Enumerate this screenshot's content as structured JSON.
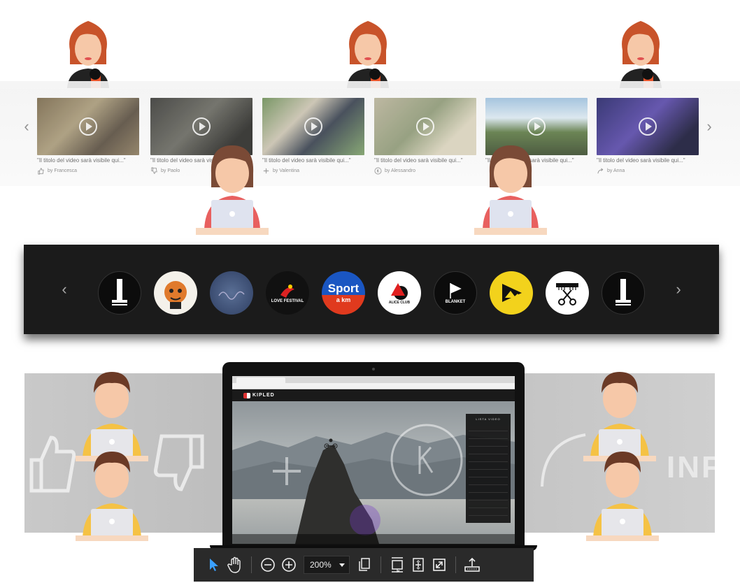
{
  "video_strip": {
    "videos": [
      {
        "title": "\"Il titolo del video sarà visibile qui...\"",
        "author": "by Francesca",
        "icon": "thumbs-up-icon"
      },
      {
        "title": "\"Il titolo del video sarà visibile qui...\"",
        "author": "by Paolo",
        "icon": "thumbs-down-icon"
      },
      {
        "title": "\"Il titolo del video sarà visibile qui...\"",
        "author": "by Valentina",
        "icon": "plus-icon"
      },
      {
        "title": "\"Il titolo del video sarà visibile qui...\"",
        "author": "by Alessandro",
        "icon": "k-circle-icon"
      },
      {
        "title": "\"Il titolo del video sarà visibile qui...\"",
        "author": "",
        "icon": ""
      },
      {
        "title": "\"Il titolo del video sarà visibile qui...\"",
        "author": "by Anna",
        "icon": "share-icon"
      }
    ]
  },
  "brands": [
    {
      "label": "",
      "name": "brand-logo-1"
    },
    {
      "label": "",
      "name": "brand-logo-2"
    },
    {
      "label": "",
      "name": "brand-logo-3"
    },
    {
      "label": "LOVE FESTIVAL",
      "name": "brand-logo-love-festival"
    },
    {
      "label": "Sport",
      "sublabel": "a km",
      "name": "brand-logo-sport"
    },
    {
      "label": "ALICE CLUB",
      "name": "brand-logo-alice-club"
    },
    {
      "label": "BLANKET",
      "name": "brand-logo-blanket"
    },
    {
      "label": "",
      "name": "brand-logo-play"
    },
    {
      "label": "",
      "name": "brand-logo-barber"
    },
    {
      "label": "",
      "name": "brand-logo-10"
    }
  ],
  "bottom_band": {
    "ghost_text": "INF"
  },
  "laptop": {
    "site_name": "KIPLED",
    "playlist_title": "LISTA VIDEO"
  },
  "toolbar": {
    "zoom": "200%"
  },
  "colors": {
    "brand_bar": "#1b1b1b",
    "toolbar": "#2a2a2a",
    "accent_pointer": "#3aa0ff"
  }
}
